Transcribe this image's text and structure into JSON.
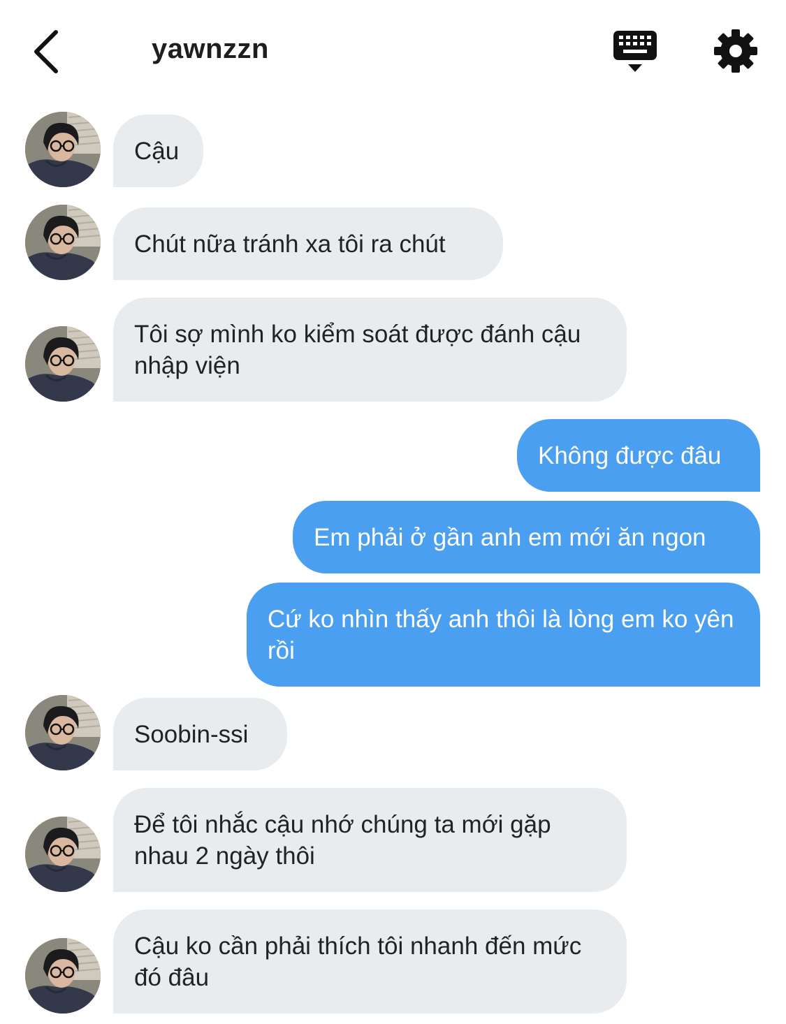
{
  "header": {
    "title": "yawnzzn",
    "back_icon": "chevron-left-icon",
    "keyboard_icon": "keyboard-icon",
    "settings_icon": "gear-icon"
  },
  "colors": {
    "incoming_bubble": "#e9ecef",
    "outgoing_bubble": "#4a9ff0",
    "outgoing_text": "#ffffff"
  },
  "messages": [
    {
      "sender": "other",
      "text": "Cậu"
    },
    {
      "sender": "other",
      "text": "Chút nữa tránh xa tôi ra chút"
    },
    {
      "sender": "other",
      "text": "Tôi sợ mình ko kiểm soát được đánh cậu nhập viện"
    },
    {
      "sender": "me",
      "text": "Không được đâu"
    },
    {
      "sender": "me",
      "text": "Em phải ở gần anh em mới ăn ngon"
    },
    {
      "sender": "me",
      "text": "Cứ ko nhìn thấy anh thôi là lòng em ko yên rồi"
    },
    {
      "sender": "other",
      "text": "Soobin-ssi"
    },
    {
      "sender": "other",
      "text": "Để tôi nhắc cậu nhớ chúng ta mới gặp nhau 2 ngày thôi"
    },
    {
      "sender": "other",
      "text": "Cậu ko cần phải thích tôi nhanh đến mức đó đâu"
    }
  ]
}
